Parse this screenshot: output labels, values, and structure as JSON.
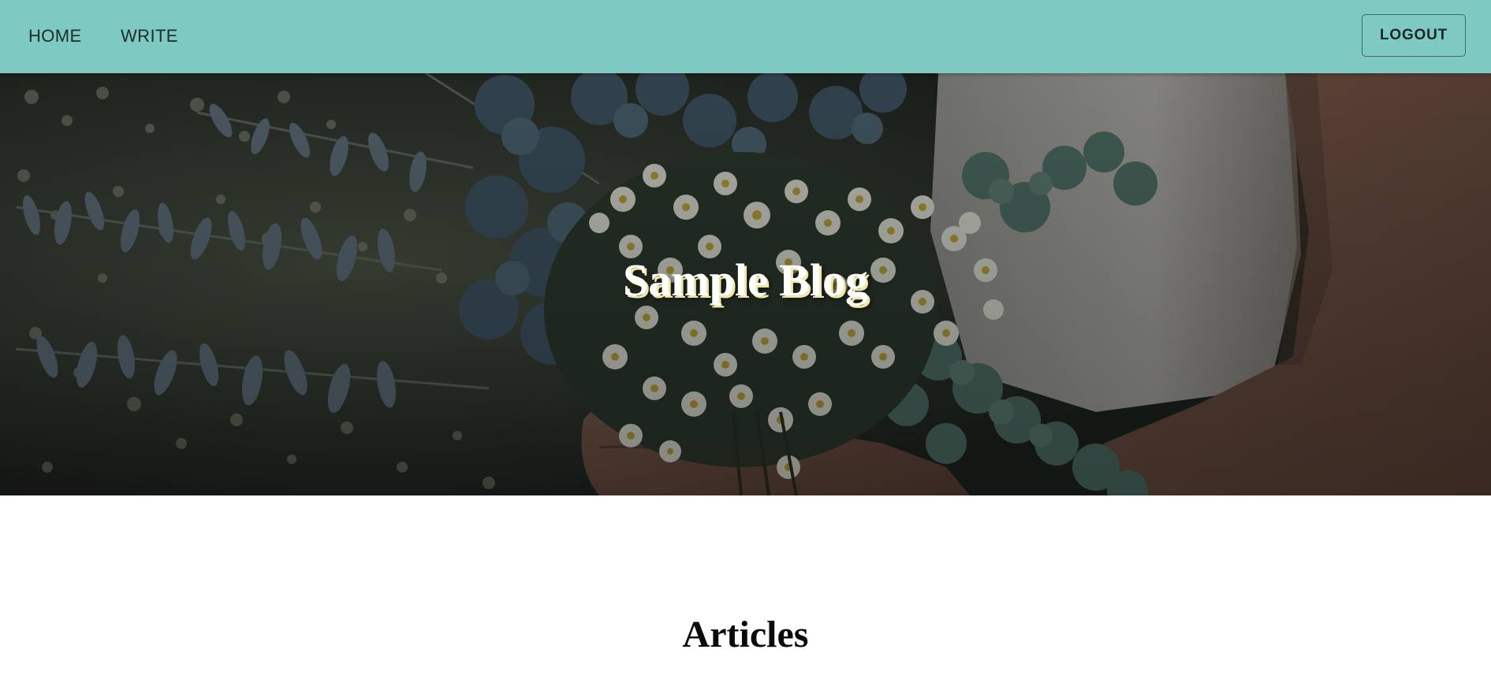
{
  "nav": {
    "links": [
      {
        "label": "HOME"
      },
      {
        "label": "WRITE"
      }
    ],
    "logout_label": "LOGOUT"
  },
  "hero": {
    "title": "Sample Blog"
  },
  "main": {
    "section_heading": "Articles"
  },
  "colors": {
    "navbar": "#7ecac3",
    "page_background": "#ffffff",
    "hero_title": "#ffffff",
    "hero_title_shadow": "#f0e7a6"
  }
}
